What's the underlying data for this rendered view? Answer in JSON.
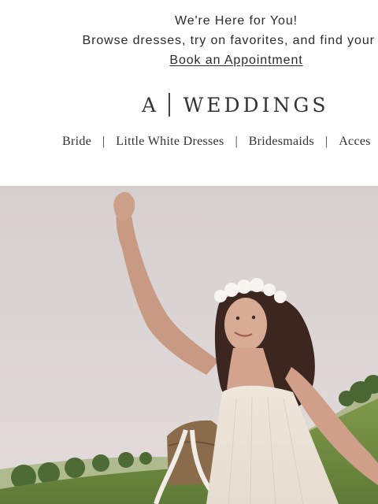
{
  "banner": {
    "headline": "We're Here for You!",
    "subtext": "Browse dresses, try on favorites, and find your lo",
    "cta_link": "Book an Appointment"
  },
  "brand": {
    "logo_left": "A",
    "logo_right": "WEDDINGS"
  },
  "nav": {
    "items": [
      "Bride",
      "Little White Dresses",
      "Bridesmaids",
      "Acces"
    ],
    "separator": "|"
  },
  "colors": {
    "text": "#2b2b2b",
    "sky": "#d9d2d3",
    "grass": "#6d8a3f"
  }
}
